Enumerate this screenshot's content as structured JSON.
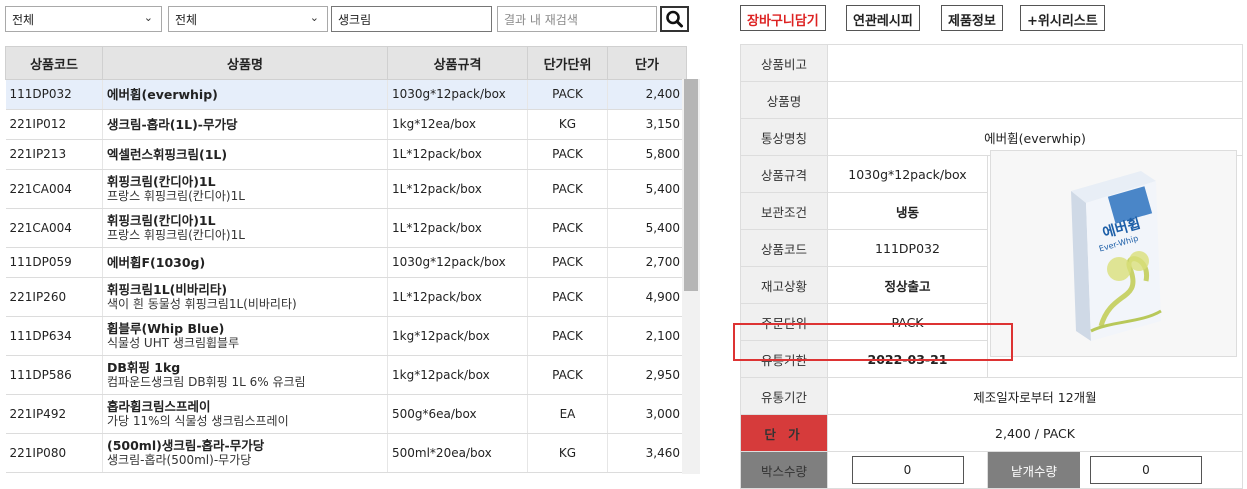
{
  "filters": {
    "category1": "전체",
    "category2": "전체",
    "keyword": "생크림",
    "refine_placeholder": "결과 내 재검색"
  },
  "product_table": {
    "headers": [
      "상품코드",
      "상품명",
      "상품규격",
      "단가단위",
      "단가"
    ],
    "rows": [
      {
        "code": "111DP032",
        "name": "에버휩(everwhip)",
        "sub": "",
        "spec": "1030g*12pack/box",
        "unit": "PACK",
        "price": "2,400"
      },
      {
        "code": "221IP012",
        "name": "생크림-홉라(1L)-무가당",
        "sub": "",
        "spec": "1kg*12ea/box",
        "unit": "KG",
        "price": "3,150"
      },
      {
        "code": "221IP213",
        "name": "엑셀런스휘핑크림(1L)",
        "sub": "",
        "spec": "1L*12pack/box",
        "unit": "PACK",
        "price": "5,800"
      },
      {
        "code": "221CA004",
        "name": "휘핑크림(칸디아)1L",
        "sub": "프랑스 휘핑크림(칸디아)1L",
        "spec": "1L*12pack/box",
        "unit": "PACK",
        "price": "5,400"
      },
      {
        "code": "221CA004",
        "name": "휘핑크림(칸디아)1L",
        "sub": "프랑스 휘핑크림(칸디아)1L",
        "spec": "1L*12pack/box",
        "unit": "PACK",
        "price": "5,400"
      },
      {
        "code": "111DP059",
        "name": "에버휩F(1030g)",
        "sub": "",
        "spec": "1030g*12pack/box",
        "unit": "PACK",
        "price": "2,700"
      },
      {
        "code": "221IP260",
        "name": "휘핑크림1L(비바리타)",
        "sub": "색이 흰 동물성 휘핑크림1L(비바리타)",
        "spec": "1L*12pack/box",
        "unit": "PACK",
        "price": "4,900"
      },
      {
        "code": "111DP634",
        "name": "휩블루(Whip Blue)",
        "sub": "식물성 UHT 생크림휩블루",
        "spec": "1kg*12pack/box",
        "unit": "PACK",
        "price": "2,100"
      },
      {
        "code": "111DP586",
        "name": "DB휘핑 1kg",
        "sub": "컴파운드생크림 DB휘핑 1L 6% 유크림",
        "spec": "1kg*12pack/box",
        "unit": "PACK",
        "price": "2,950"
      },
      {
        "code": "221IP492",
        "name": "홉라휩크림스프레이",
        "sub": "가당 11%의 식물성 생크림스프레이",
        "spec": "500g*6ea/box",
        "unit": "EA",
        "price": "3,000"
      },
      {
        "code": "221IP080",
        "name": "(500ml)생크림-홉라-무가당",
        "sub": "생크림-홉라(500ml)-무가당",
        "spec": "500ml*20ea/box",
        "unit": "KG",
        "price": "3,460"
      }
    ]
  },
  "actions": {
    "cart": "장바구니담기",
    "recipe": "연관레시피",
    "info": "제품정보",
    "wishlist": "+위시리스트"
  },
  "detail": {
    "note_label": "상품비고",
    "note_value": "",
    "name_label": "상품명",
    "name_value": "",
    "alias_label": "통상명칭",
    "alias_value": "에버휩(everwhip)",
    "spec_label": "상품규격",
    "spec_value": "1030g*12pack/box",
    "storage_label": "보관조건",
    "storage_value": "냉동",
    "code_label": "상품코드",
    "code_value": "111DP032",
    "stock_label": "재고상황",
    "stock_value": "정상출고",
    "order_unit_label": "주문단위",
    "order_unit_value": "PACK",
    "expiry_label": "유통기한",
    "expiry_value": "2022-03-21",
    "shelf_label": "유통기간",
    "shelf_value": "제조일자로부터 12개월",
    "price_label": "단 가",
    "price_value": "2,400 / PACK",
    "box_qty_label": "박스수량",
    "box_qty_value": "0",
    "each_qty_label": "낱개수량",
    "each_qty_value": "0"
  },
  "product_image": {
    "brand_text": "에버휩",
    "sub_text": "Ever-Whip"
  }
}
